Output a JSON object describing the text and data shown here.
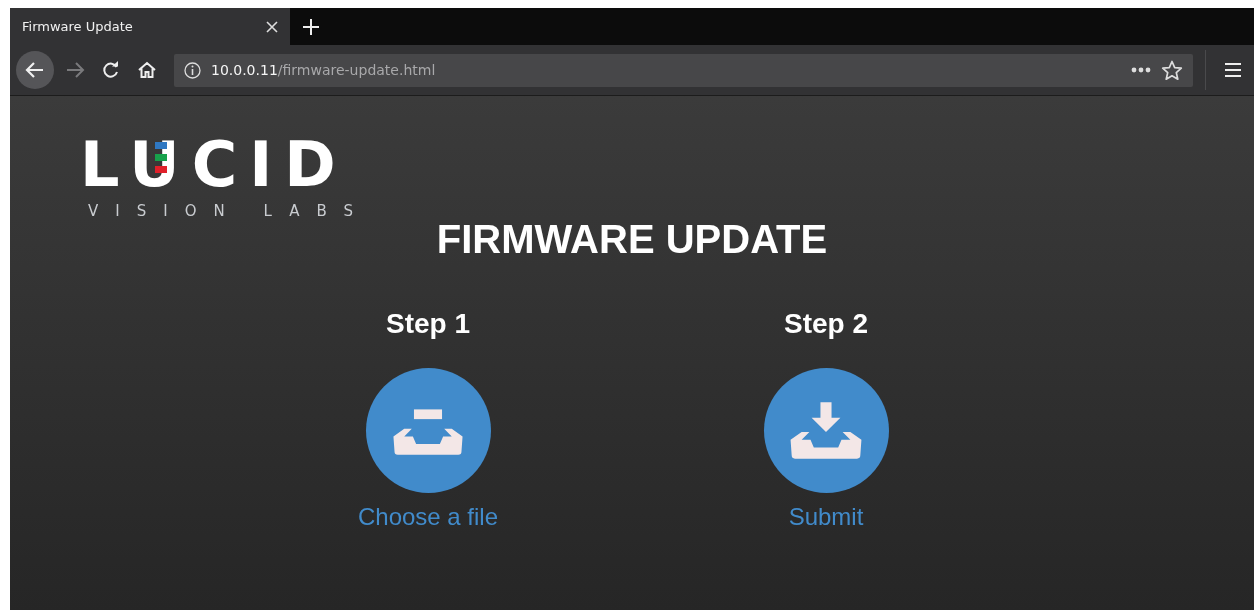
{
  "browser": {
    "tabs": [
      {
        "title": "Firmware Update",
        "selected": true
      }
    ],
    "url": {
      "host": "10.0.0.11",
      "path": "/firmware-update.html"
    }
  },
  "page": {
    "logo": {
      "wordmark": "LUCID",
      "tagline": "VISION LABS"
    },
    "title": "FIRMWARE UPDATE",
    "steps": [
      {
        "heading": "Step 1",
        "kind": "choose",
        "action": "Choose a file"
      },
      {
        "heading": "Step 2",
        "kind": "submit",
        "action": "Submit"
      }
    ]
  }
}
